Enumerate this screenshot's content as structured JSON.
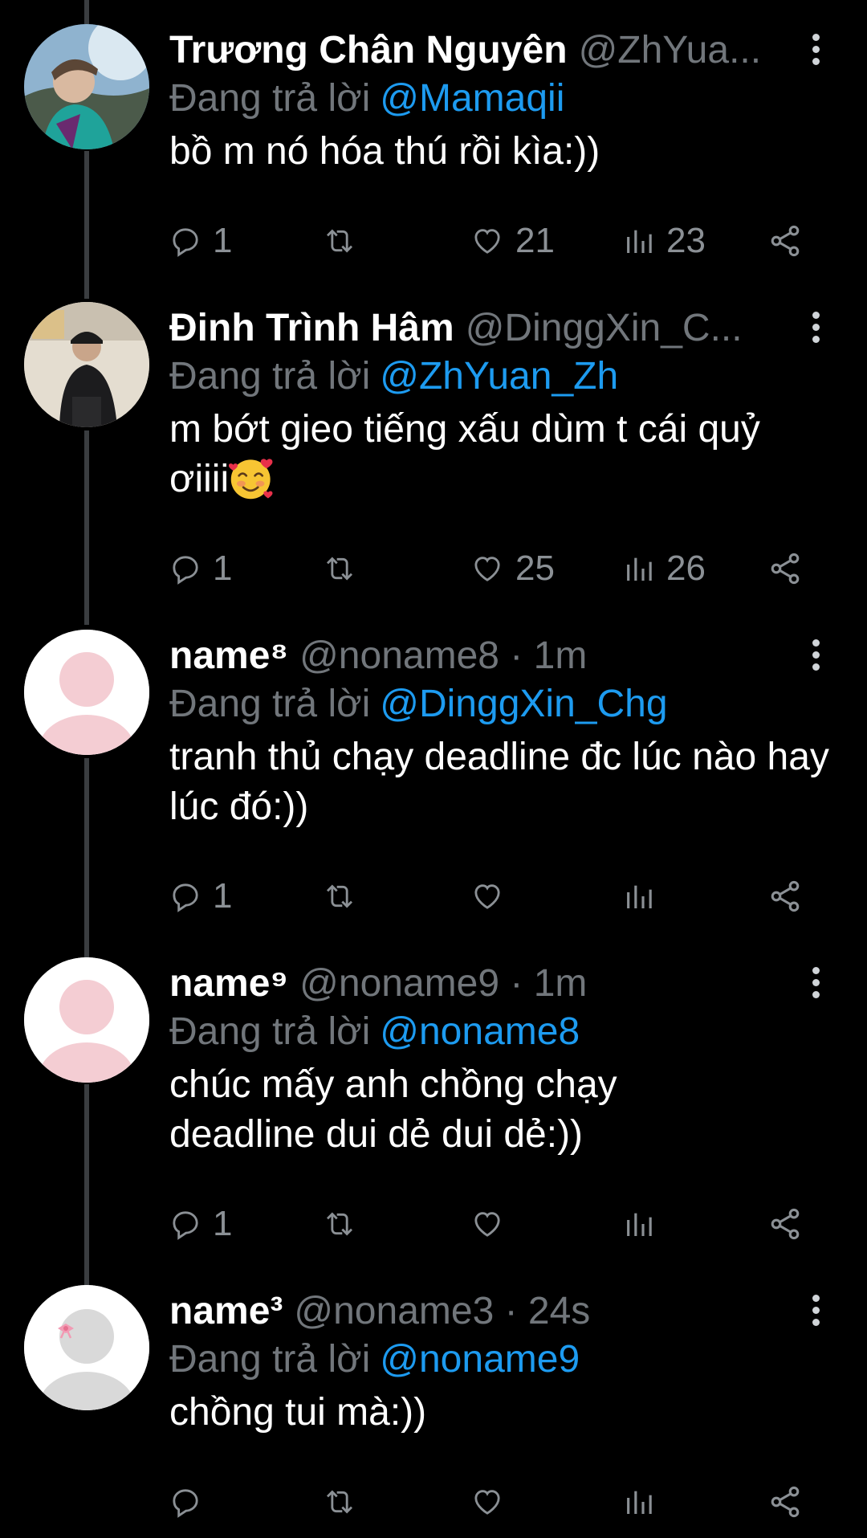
{
  "reply_prefix": "Đang trả lời",
  "colors": {
    "background": "#000000",
    "text": "#ffffff",
    "secondary": "#71767b",
    "link": "#1d9bf0",
    "thread_line": "#3a3d40"
  },
  "icons": {
    "reply": "reply-icon",
    "retweet": "retweet-icon",
    "like": "heart-icon",
    "views": "views-icon",
    "share": "share-icon",
    "more": "more-vertical-icon"
  },
  "tweets": [
    {
      "name": "Trương Chân Nguyên",
      "handle_meta": "@ZhYua...",
      "reply_to": "@Mamaqii",
      "text": "bồ m nó hóa thú rồi kìa:))",
      "replies": "1",
      "likes": "21",
      "views": "23"
    },
    {
      "name": "Đinh Trình Hâm",
      "handle_meta": "@DinggXin_C...",
      "reply_to": "@ZhYuan_Zh",
      "text": "m bớt gieo tiếng xấu dùm t cái quỷ ơiiii",
      "emoji": "smiling-face-with-hearts",
      "replies": "1",
      "likes": "25",
      "views": "26"
    },
    {
      "name": "name⁸",
      "handle_meta": "@noname8 · 1m",
      "reply_to": "@DinggXin_Chg",
      "text": "tranh thủ chạy deadline đc lúc nào hay lúc đó:))",
      "replies": "1",
      "likes": "",
      "views": ""
    },
    {
      "name": "name⁹",
      "handle_meta": "@noname9 · 1m",
      "reply_to": "@noname8",
      "text": "chúc mấy anh chồng chạy deadline dui dẻ dui dẻ:))",
      "replies": "1",
      "likes": "",
      "views": ""
    },
    {
      "name": "name³",
      "handle_meta": "@noname3 · 24s",
      "reply_to": "@noname9",
      "text": "chồng tui mà:))",
      "replies": "",
      "likes": "",
      "views": ""
    }
  ]
}
